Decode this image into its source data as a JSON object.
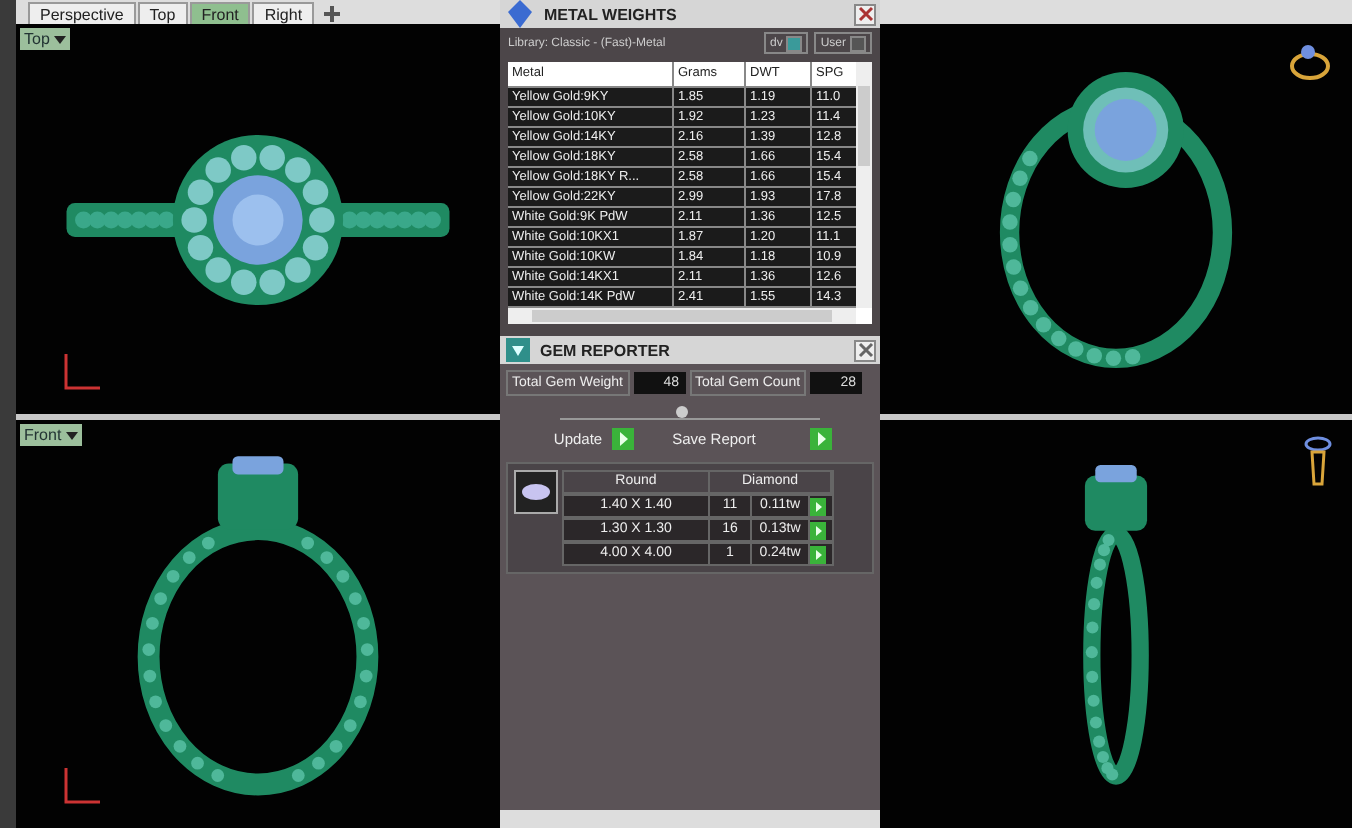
{
  "view_tabs": [
    {
      "label": "Perspective",
      "selected": false
    },
    {
      "label": "Top",
      "selected": false
    },
    {
      "label": "Front",
      "selected": true
    },
    {
      "label": "Right",
      "selected": false
    }
  ],
  "viewports": [
    {
      "kind": "top",
      "label": "Top"
    },
    {
      "kind": "perspective"
    },
    {
      "kind": "front",
      "label": "Front"
    },
    {
      "kind": "right"
    }
  ],
  "metal_weights": {
    "title": "METAL WEIGHTS",
    "library": "Library: Classic - (Fast)-Metal",
    "toggles": [
      {
        "label": "dv",
        "checked": true
      },
      {
        "label": "User",
        "checked": false
      }
    ],
    "columns": [
      "Metal",
      "Grams",
      "DWT",
      "SPG"
    ],
    "rows": [
      [
        "Yellow Gold:9KY",
        "1.85",
        "1.19",
        "11.0"
      ],
      [
        "Yellow Gold:10KY",
        "1.92",
        "1.23",
        "11.4"
      ],
      [
        "Yellow Gold:14KY",
        "2.16",
        "1.39",
        "12.8"
      ],
      [
        "Yellow Gold:18KY",
        "2.58",
        "1.66",
        "15.4"
      ],
      [
        "Yellow Gold:18KY R...",
        "2.58",
        "1.66",
        "15.4"
      ],
      [
        "Yellow Gold:22KY",
        "2.99",
        "1.93",
        "17.8"
      ],
      [
        "White Gold:9K PdW",
        "2.11",
        "1.36",
        "12.5"
      ],
      [
        "White Gold:10KX1",
        "1.87",
        "1.20",
        "11.1"
      ],
      [
        "White Gold:10KW",
        "1.84",
        "1.18",
        "10.9"
      ],
      [
        "White Gold:14KX1",
        "2.11",
        "1.36",
        "12.6"
      ],
      [
        "White Gold:14K PdW",
        "2.41",
        "1.55",
        "14.3"
      ]
    ]
  },
  "gem_reporter": {
    "title": "GEM REPORTER",
    "weight_label": "Total Gem Weight",
    "weight": "48",
    "count_label": "Total Gem Count",
    "count": "28",
    "buttons": [
      "Update",
      "Save Report"
    ],
    "columns": [
      "Round",
      "Diamond"
    ],
    "rows": [
      {
        "size": "1.40 X 1.40",
        "count": "11",
        "weight": "0.11tw"
      },
      {
        "size": "1.30 X 1.30",
        "count": "16",
        "weight": "0.13tw"
      },
      {
        "size": "4.00 X 4.00",
        "count": "1",
        "weight": "0.24tw"
      }
    ]
  }
}
